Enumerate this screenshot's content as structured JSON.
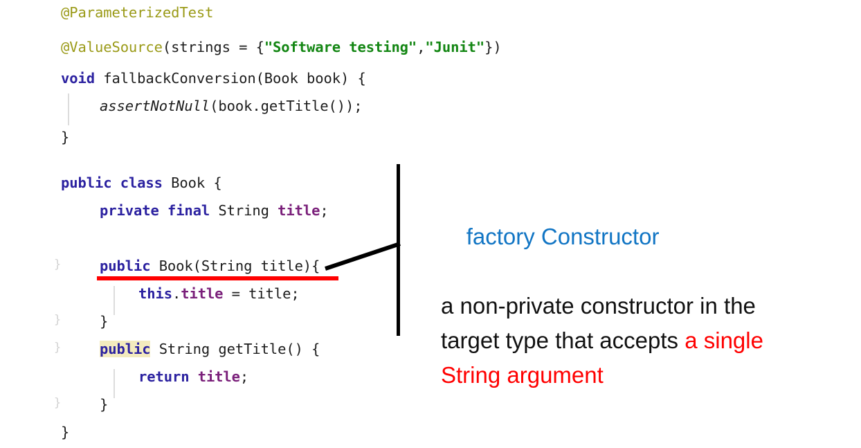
{
  "editor": {
    "language": "java",
    "code_lines": [
      {
        "id": "line-parameterized-test",
        "indent": 0,
        "text": "@ParameterizedTest",
        "tokens": [
          {
            "t": "@ParameterizedTest",
            "c": "tok-anno"
          }
        ]
      },
      {
        "id": "line-value-source",
        "indent": 0,
        "text": "@ValueSource(strings = {\"Software testing\",\"Junit\"})",
        "tokens": [
          {
            "t": "@ValueSource",
            "c": "tok-anno"
          },
          {
            "t": "(strings = {",
            "c": "tok-plain"
          },
          {
            "t": "\"Software testing\"",
            "c": "tok-str"
          },
          {
            "t": ",",
            "c": "tok-plain"
          },
          {
            "t": "\"Junit\"",
            "c": "tok-str"
          },
          {
            "t": "})",
            "c": "tok-plain"
          }
        ]
      },
      {
        "id": "line-fallback-conversion",
        "indent": 0,
        "text": "void fallbackConversion(Book book) {",
        "tokens": [
          {
            "t": "void",
            "c": "tok-kw"
          },
          {
            "t": " fallbackConversion(Book book) {",
            "c": "tok-plain"
          }
        ]
      },
      {
        "id": "line-assert-not-null",
        "indent": 1,
        "text": "assertNotNull(book.getTitle());",
        "tokens": [
          {
            "t": "assertNotNull",
            "c": "tok-ital"
          },
          {
            "t": "(book.getTitle());",
            "c": "tok-plain"
          }
        ]
      },
      {
        "id": "line-close-method",
        "indent": 0,
        "text": "}",
        "tokens": [
          {
            "t": "}",
            "c": "tok-plain"
          }
        ]
      },
      {
        "id": "line-blank-1",
        "indent": 0,
        "text": "",
        "tokens": []
      },
      {
        "id": "line-class-book",
        "indent": 0,
        "text": "public class Book {",
        "tokens": [
          {
            "t": "public",
            "c": "tok-kw"
          },
          {
            "t": " ",
            "c": "tok-plain"
          },
          {
            "t": "class",
            "c": "tok-kw"
          },
          {
            "t": " Book {",
            "c": "tok-plain"
          }
        ]
      },
      {
        "id": "line-field-title",
        "indent": 1,
        "text": "private final String title;",
        "tokens": [
          {
            "t": "private",
            "c": "tok-kw"
          },
          {
            "t": " ",
            "c": "tok-plain"
          },
          {
            "t": "final",
            "c": "tok-kw"
          },
          {
            "t": " String ",
            "c": "tok-plain"
          },
          {
            "t": "title",
            "c": "tok-field"
          },
          {
            "t": ";",
            "c": "tok-plain"
          }
        ]
      },
      {
        "id": "line-blank-2",
        "indent": 0,
        "text": "",
        "tokens": []
      },
      {
        "id": "line-constructor",
        "indent": 1,
        "text": "public Book(String title){",
        "tokens": [
          {
            "t": "public",
            "c": "tok-kw"
          },
          {
            "t": " Book(String title){",
            "c": "tok-plain"
          }
        ]
      },
      {
        "id": "line-this-title",
        "indent": 2,
        "text": "this.title = title;",
        "tokens": [
          {
            "t": "this",
            "c": "tok-kw"
          },
          {
            "t": ".",
            "c": "tok-plain"
          },
          {
            "t": "title",
            "c": "tok-field"
          },
          {
            "t": " = title;",
            "c": "tok-plain"
          }
        ]
      },
      {
        "id": "line-close-constructor",
        "indent": 1,
        "text": "}",
        "tokens": [
          {
            "t": "}",
            "c": "tok-plain"
          }
        ]
      },
      {
        "id": "line-get-title",
        "indent": 1,
        "text": "public String getTitle() {",
        "tokens": [
          {
            "t": "public",
            "c": "tok-kw hl-yellow"
          },
          {
            "t": " String getTitle() {",
            "c": "tok-plain"
          }
        ]
      },
      {
        "id": "line-return-title",
        "indent": 2,
        "text": "return title;",
        "tokens": [
          {
            "t": "return",
            "c": "tok-kw"
          },
          {
            "t": " ",
            "c": "tok-plain"
          },
          {
            "t": "title",
            "c": "tok-field"
          },
          {
            "t": ";",
            "c": "tok-plain"
          }
        ]
      },
      {
        "id": "line-close-get-title",
        "indent": 1,
        "text": "}",
        "tokens": [
          {
            "t": "}",
            "c": "tok-plain"
          }
        ]
      },
      {
        "id": "line-close-class",
        "indent": 0,
        "text": "}",
        "tokens": [
          {
            "t": "}",
            "c": "tok-plain"
          }
        ]
      }
    ],
    "fold_markers": [
      "⨍",
      "⨍",
      "⨍",
      "⨍"
    ],
    "highlight": {
      "keyword": "public",
      "color": "#F3EBBE"
    }
  },
  "underline": {
    "target_text": "public Book(String title){",
    "color": "#FF0000"
  },
  "callout": {
    "bracket_color": "#000000",
    "title": "factory Constructor",
    "title_color": "#1175C4",
    "body_lines": [
      [
        {
          "t": "a non-private constructor in the",
          "c": "ann-black"
        }
      ],
      [
        {
          "t": "target type that accepts ",
          "c": "ann-black"
        },
        {
          "t": "a single",
          "c": "ann-red"
        }
      ],
      [
        {
          "t": "String argument",
          "c": "ann-red"
        }
      ]
    ],
    "body_color": "#111111",
    "emphasis_color": "#FF0000"
  }
}
